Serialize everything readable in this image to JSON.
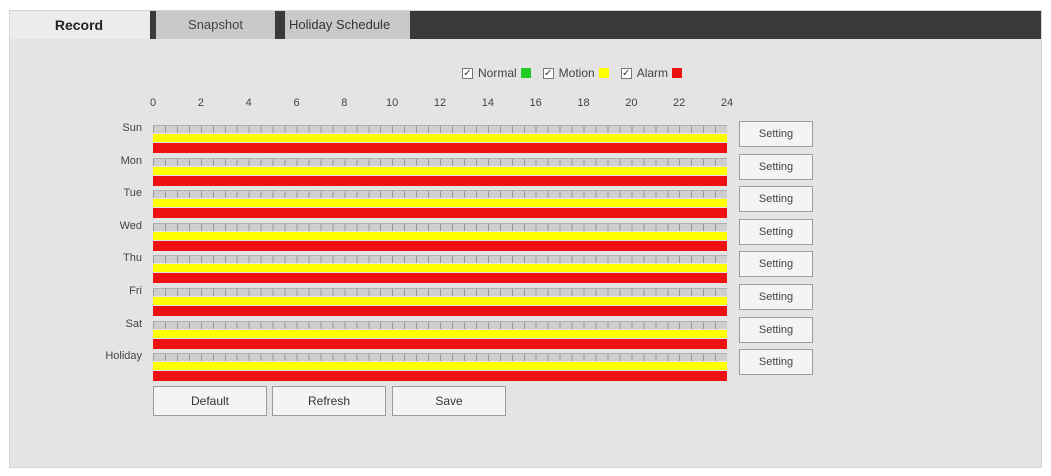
{
  "tabs": [
    {
      "label": "Record",
      "active": true
    },
    {
      "label": "Snapshot",
      "active": false
    },
    {
      "label": "Holiday Schedule",
      "active": false
    }
  ],
  "legend": [
    {
      "label": "Normal",
      "checked": true,
      "color": "#22cc22"
    },
    {
      "label": "Motion",
      "checked": true,
      "color": "#ffff00"
    },
    {
      "label": "Alarm",
      "checked": true,
      "color": "#ee1111"
    }
  ],
  "hours": [
    "0",
    "2",
    "4",
    "6",
    "8",
    "10",
    "12",
    "14",
    "16",
    "18",
    "20",
    "22",
    "24"
  ],
  "days": [
    {
      "label": "Sun",
      "setting_label": "Setting"
    },
    {
      "label": "Mon",
      "setting_label": "Setting"
    },
    {
      "label": "Tue",
      "setting_label": "Setting"
    },
    {
      "label": "Wed",
      "setting_label": "Setting"
    },
    {
      "label": "Thu",
      "setting_label": "Setting"
    },
    {
      "label": "Fri",
      "setting_label": "Setting"
    },
    {
      "label": "Sat",
      "setting_label": "Setting"
    },
    {
      "label": "Holiday",
      "setting_label": "Setting"
    }
  ],
  "actions": {
    "default_label": "Default",
    "refresh_label": "Refresh",
    "save_label": "Save"
  },
  "colors": {
    "motion": "#ffff00",
    "alarm": "#ee1111",
    "normal": "#22cc22"
  }
}
